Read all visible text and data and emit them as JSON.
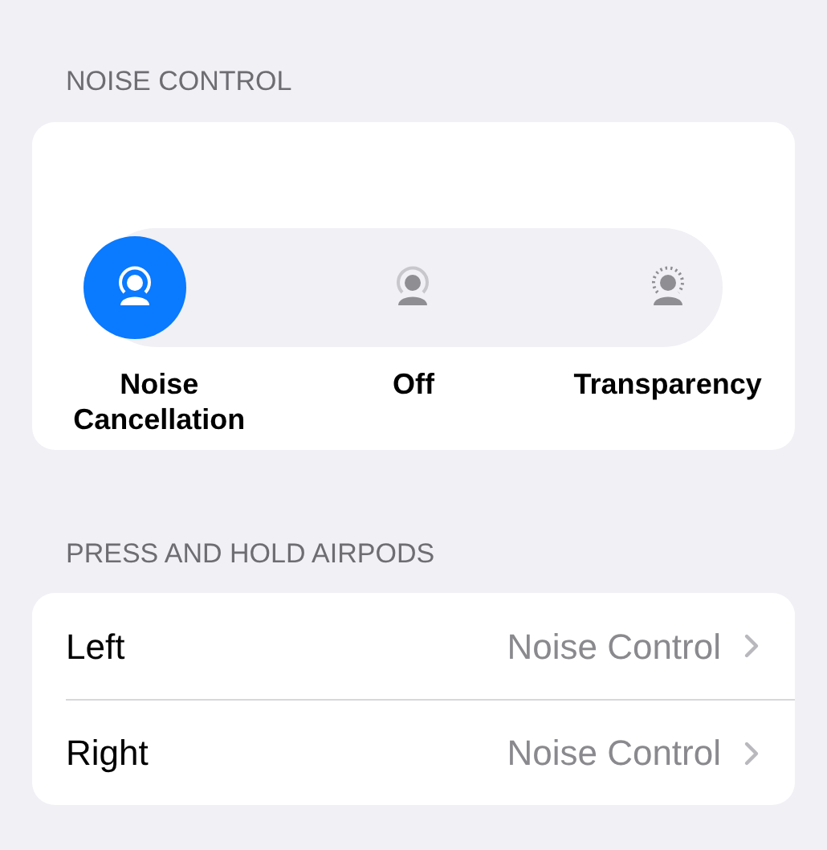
{
  "noise_control": {
    "header": "NOISE CONTROL",
    "modes": [
      {
        "kind": "cancellation",
        "label": "Noise Cancellation",
        "selected": true
      },
      {
        "kind": "off",
        "label": "Off",
        "selected": false
      },
      {
        "kind": "transparency",
        "label": "Transparency",
        "selected": false
      }
    ]
  },
  "press_and_hold": {
    "header": "PRESS AND HOLD AIRPODS",
    "rows": [
      {
        "label": "Left",
        "value": "Noise Control"
      },
      {
        "label": "Right",
        "value": "Noise Control"
      }
    ]
  }
}
